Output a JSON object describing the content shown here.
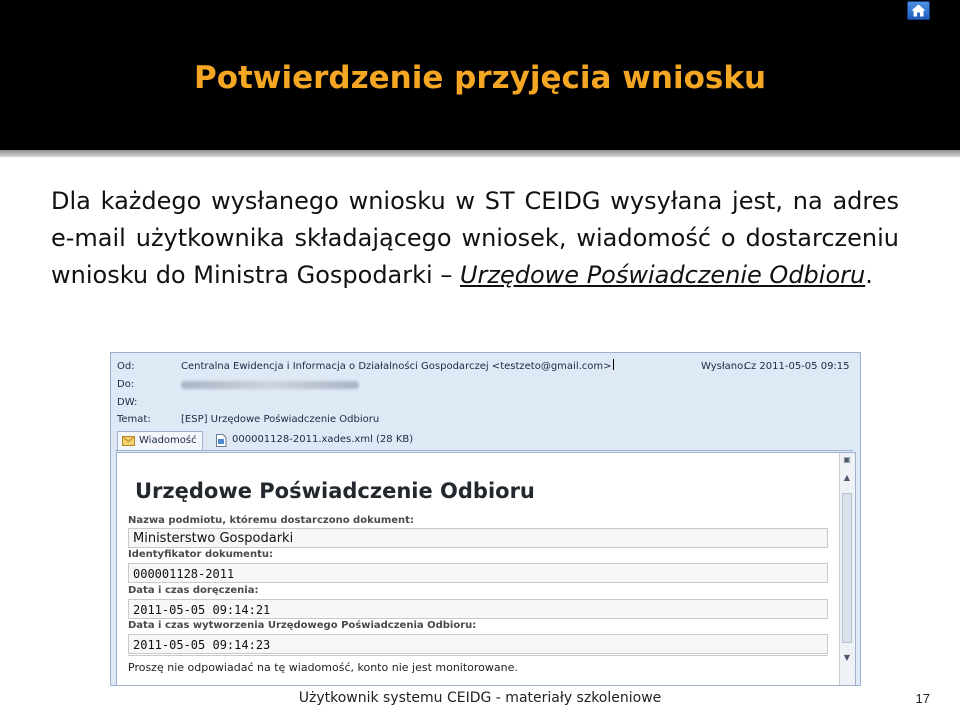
{
  "slide": {
    "title": "Potwierdzenie przyjęcia wniosku",
    "body_main": "Dla każdego wysłanego wniosku w ST CEIDG wysyłana jest, na adres e-mail użytkownika składającego wniosek, wiadomość o dostarczeniu wniosku do Ministra Gospodarki – ",
    "body_link": "Urzędowe Poświadczenie Odbioru",
    "body_end": ".",
    "footer": "Użytkownik systemu CEIDG - materiały szkoleniowe",
    "page_number": "17"
  },
  "email": {
    "from_label": "Od:",
    "from_value": "Centralna Ewidencja i Informacja o Działalności Gospodarczej <testzeto@gmail.com>",
    "to_label": "Do:",
    "cc_label": "DW:",
    "subject_label": "Temat:",
    "subject_value": "[ESP] Urzędowe Poświadczenie Odbioru",
    "sent_label": "Wysłano:",
    "sent_value": "Cz 2011-05-05 09:15",
    "tab_message": "Wiadomość",
    "tab_attachment": "000001128-2011.xades.xml (28 KB)"
  },
  "document": {
    "title": "Urzędowe Poświadczenie Odbioru",
    "fields": [
      {
        "label": "Nazwa podmiotu, któremu dostarczono dokument:",
        "value": "Ministerstwo Gospodarki"
      },
      {
        "label": "Identyfikator dokumentu:",
        "value": "000001128-2011"
      },
      {
        "label": "Data i czas doręczenia:",
        "value": "2011-05-05 09:14:21"
      },
      {
        "label": "Data i czas wytworzenia Urzędowego Poświadczenia Odbioru:",
        "value": "2011-05-05 09:14:23"
      }
    ],
    "notice": "Proszę nie odpowiadać na tę wiadomość, konto nie jest monitorowane."
  },
  "colors": {
    "title": "#f5a622",
    "header_band": "#000000",
    "mail_header_bg": "#dfe8f5"
  }
}
